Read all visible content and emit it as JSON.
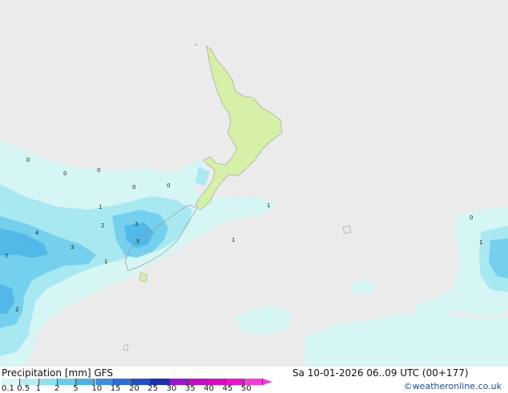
{
  "map": {
    "background": "#ebebeb",
    "land_color": "#d6f0a8",
    "precip_labels": [
      "0",
      "0",
      "0",
      "0",
      "0",
      "0",
      "1",
      "1",
      "1",
      "1",
      "1",
      "2",
      "2",
      "3",
      "3",
      "4",
      "5",
      "7"
    ]
  },
  "footer": {
    "title": "Precipitation [mm]  GFS",
    "valid_time": "Sa 10-01-2026 06..09 UTC (00+177)",
    "credit": "©weatheronline.co.uk"
  },
  "legend": {
    "ticks": [
      "0.1",
      "0.5",
      "1",
      "2",
      "5",
      "10",
      "15",
      "20",
      "25",
      "30",
      "35",
      "40",
      "45",
      "50"
    ],
    "colors": [
      "#d8f7f7",
      "#b4eef2",
      "#8ee0ee",
      "#6accea",
      "#4cb2e6",
      "#3c8ee0",
      "#2e6ed8",
      "#1f4fc8",
      "#1a2fa8",
      "#9c14d4",
      "#c20cc8",
      "#dc0ac4",
      "#f010d0",
      "#f83ad8"
    ]
  }
}
